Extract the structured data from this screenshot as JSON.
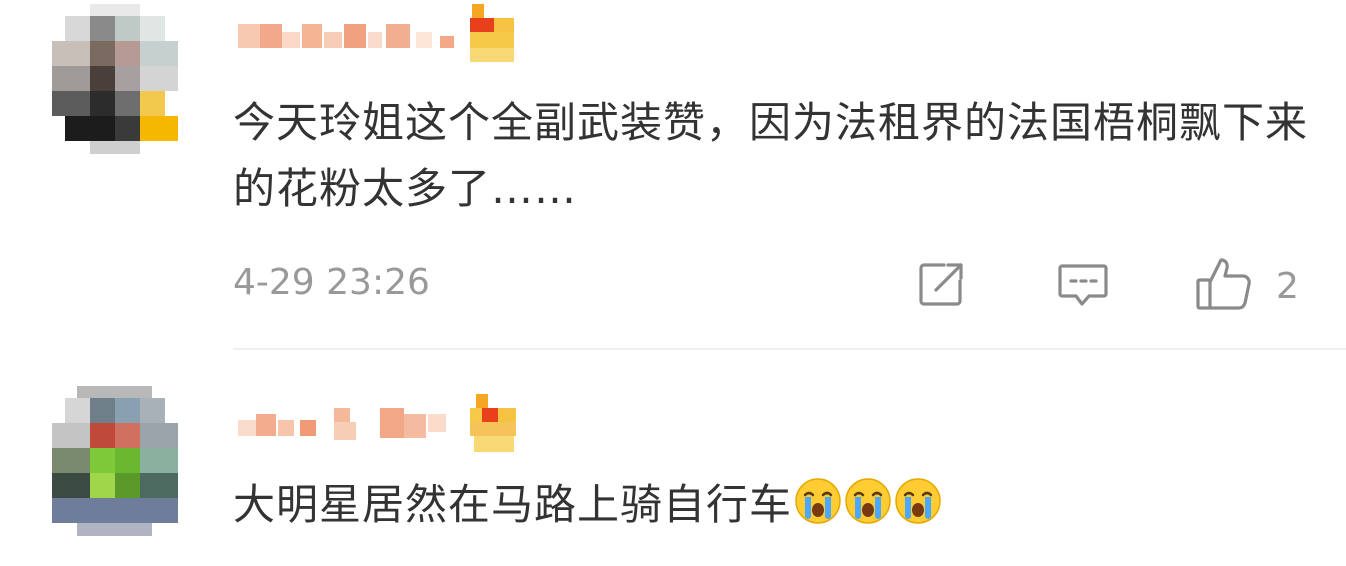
{
  "comments": [
    {
      "text": "今天玲姐这个全副武装赞，因为法租界的法国梧桐飘下来的花粉太多了……",
      "timestamp": "4-29 23:26",
      "like_count": "2",
      "icons": {
        "share": "share-icon",
        "reply": "comment-icon",
        "like": "thumbs-up-icon"
      }
    },
    {
      "text": "大明星居然在马路上骑自行车",
      "emoji": [
        "crying-emoji",
        "crying-emoji",
        "crying-emoji"
      ]
    }
  ],
  "colors": {
    "text": "#333333",
    "meta": "#999999",
    "icon": "#8a8a8a",
    "divider": "#efefef",
    "emoji_face": "#ffcc33",
    "emoji_tear": "#4aa8ff"
  }
}
